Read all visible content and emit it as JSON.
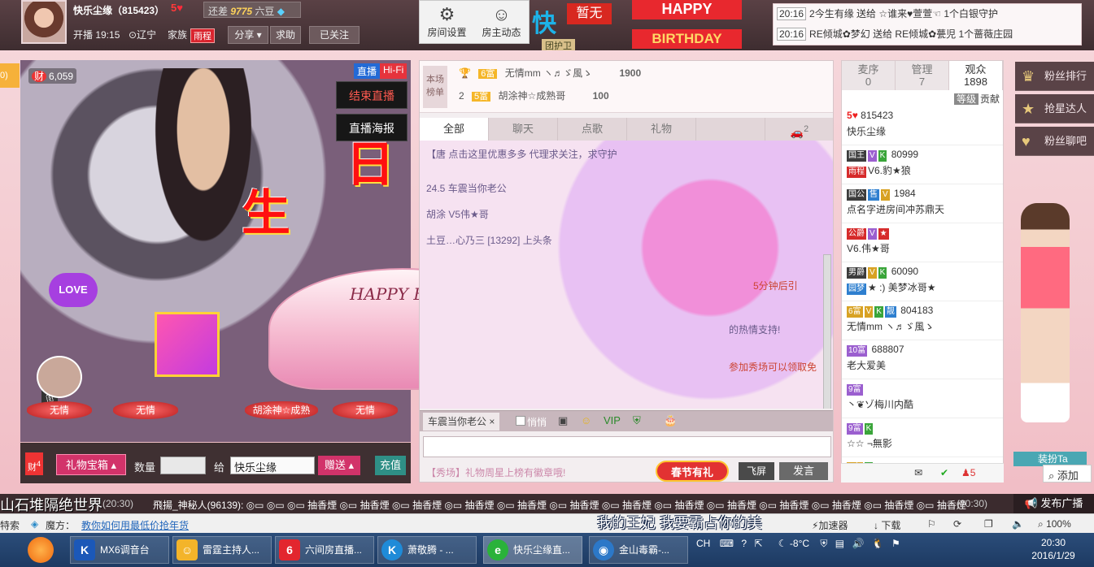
{
  "host": {
    "name": "快乐尘缘（815423）",
    "level": "5",
    "diff_prefix": "还差",
    "diff_value": "9775",
    "diff_unit": "六豆",
    "open_time": "开播 19:15",
    "location": "辽宁",
    "family_label": "家族",
    "family_badge": "雨程",
    "share_label": "分享",
    "help_label": "求助",
    "follow_label": "已关注"
  },
  "room_tools": {
    "settings_label": "房间设置",
    "host_feed_label": "房主动态"
  },
  "banner": {
    "kuai": "快",
    "zanwu": "暂无",
    "guard": "团护卫",
    "happy": "HAPPY",
    "birthday": "BIRTHDAY"
  },
  "notices": [
    {
      "time": "20:16",
      "text": "2今生有缘 送给 ☆谁来♥萱萱☜ 1个白银守护"
    },
    {
      "time": "20:16",
      "text": "RE倾城✿梦幻 送给 RE倾城✿甍児 1个蔷薇庄园"
    }
  ],
  "left_sliver": "0)",
  "video": {
    "wealth_icon": "财",
    "wealth_value": "6,059",
    "tag_live": "直播",
    "tag_hifi": "Hi-Fi",
    "end_live_label": "结束直播",
    "poster_label": "直播海报",
    "bday_chars": [
      "生",
      "日",
      "快",
      "乐"
    ],
    "cake_text": "HAPPY BIRTHDAY",
    "love_label": "LOVE",
    "seats": [
      "无情",
      "无情",
      "胡涂神☆成熟",
      "无情"
    ]
  },
  "gift_bar": {
    "cai_label": "财",
    "cai_count": "4",
    "gift_box_label": "礼物宝箱",
    "qty_label": "数量",
    "to_label": "给",
    "to_value": "快乐尘缘",
    "send_label": "赠送",
    "charge_label": "充值"
  },
  "rank": {
    "label": "本场榜单",
    "rows": [
      {
        "no": "1",
        "level": "6富",
        "name": "无情mm ヽ♬ゞ風ゝ",
        "score": "1900"
      },
      {
        "no": "2",
        "level": "5富",
        "name": "胡涂神☆成熟哥",
        "score": "100"
      }
    ]
  },
  "chat": {
    "tabs": [
      "全部",
      "聊天",
      "点歌",
      "礼物",
      "",
      "2"
    ],
    "lines": [
      {
        "text": "【唐 点击这里优惠多多 代理求关注，求守护",
        "red": false
      },
      {
        "text": "24.5 车震当你老公",
        "red": false
      },
      {
        "text": "胡涂 V5伟★哥",
        "red": false
      },
      {
        "text": "土豆…心乃三 [13292] 上头条",
        "red": false
      },
      {
        "text": "5分钟后引",
        "red": true
      },
      {
        "text": "的热情支持!",
        "red": false
      },
      {
        "text": "参加秀场可以领取免",
        "red": true
      }
    ],
    "target": "车震当你老公",
    "quiet_label": "悄悄",
    "promo_prefix": "【秀场】礼物周星上榜有徽章哦!",
    "spring_label": "春节有礼",
    "fly_label": "飞屏",
    "say_label": "发言"
  },
  "audience": {
    "tabs": [
      {
        "label": "麦序",
        "count": "0"
      },
      {
        "label": "管理",
        "count": "7"
      },
      {
        "label": "观众",
        "count": "1898"
      }
    ],
    "sub_level": "等级",
    "sub_contrib": "贡献",
    "items": [
      {
        "badges": [
          "5"
        ],
        "id": "815423",
        "name": "快乐尘缘"
      },
      {
        "badges": [
          "国王",
          "V",
          "K"
        ],
        "id": "80999",
        "sub_badge": "雨程",
        "name": "V6.豹★狼"
      },
      {
        "badges": [
          "国公",
          "售",
          "V"
        ],
        "id": "1984",
        "name": "点名字进房间冲苏鼎天"
      },
      {
        "badges": [
          "公爵",
          "V",
          "★"
        ],
        "id": "",
        "name": "V6.伟★哥"
      },
      {
        "badges": [
          "男爵",
          "V",
          "K"
        ],
        "id": "60090",
        "sub_badge": "园梦",
        "name": "★ :) 美梦冰哥★"
      },
      {
        "badges": [
          "6富",
          "V",
          "K",
          "靓"
        ],
        "id": "804183",
        "name": "无情mm ヽ♬ゞ風ゝ"
      },
      {
        "badges": [
          "10富"
        ],
        "id": "688807",
        "name": "老大爱美"
      },
      {
        "badges": [
          "9富"
        ],
        "id": "",
        "name": "丶❦ゾ梅川内酷"
      },
      {
        "badges": [
          "9富",
          "K"
        ],
        "id": "",
        "name": "☆☆ ¬無影"
      },
      {
        "badges": [
          "6富",
          "K"
        ],
        "id": "",
        "name": ""
      }
    ],
    "online_count": "5",
    "add_label": "添加"
  },
  "fans": {
    "rank_label": "粉丝排行",
    "star_label": "抢星达人",
    "chat_label": "粉丝聊吧",
    "dress_label": "装扮Ta"
  },
  "marquee": {
    "big_text": "山石堆隔绝世界",
    "head_time": "(20:30)",
    "text": "飛揚_神秘人(96139):  ◎▭ ◎▭ ◎▭ 抽香煙 ◎▭ 抽香煙 ◎▭ 抽香煙 ◎▭ 抽香煙 ◎▭ 抽香煙 ◎▭ 抽香煙 ◎▭ 抽香煙 ◎▭ 抽香煙 ◎▭ 抽香煙 ◎▭ 抽香煙 ◎▭ 抽香煙 ◎▭ 抽香煙 ◎▭ 抽香煙",
    "tail_time": "(20:30)",
    "publish_label": "发布广播"
  },
  "browser": {
    "left_text": "特索",
    "magic_label": "魔方：",
    "magic_link": "教你如何用最低价抢年货",
    "accelerate": "加速器",
    "download": "下载",
    "zoom": "100%"
  },
  "subtitle": "我的王妃  我要霸占你的美",
  "taskbar": {
    "tasks": [
      {
        "label": "MX6调音台",
        "icon": "K",
        "color": "#1b58b8"
      },
      {
        "label": "雷霆主持人...",
        "icon": "☺",
        "color": "#f3b42a"
      },
      {
        "label": "六间房直播...",
        "icon": "6",
        "color": "#e3262e"
      },
      {
        "label": "萧敬腾 - ...",
        "icon": "K",
        "color": "#1f8bd8"
      },
      {
        "label": "快乐尘缘直...",
        "icon": "e",
        "color": "#2ab23a"
      },
      {
        "label": "金山毒霸-...",
        "icon": "◉",
        "color": "#2c78c8"
      }
    ],
    "ime": "CH",
    "temperature": "-8°C",
    "time": "20:30",
    "date": "2016/1/29"
  }
}
